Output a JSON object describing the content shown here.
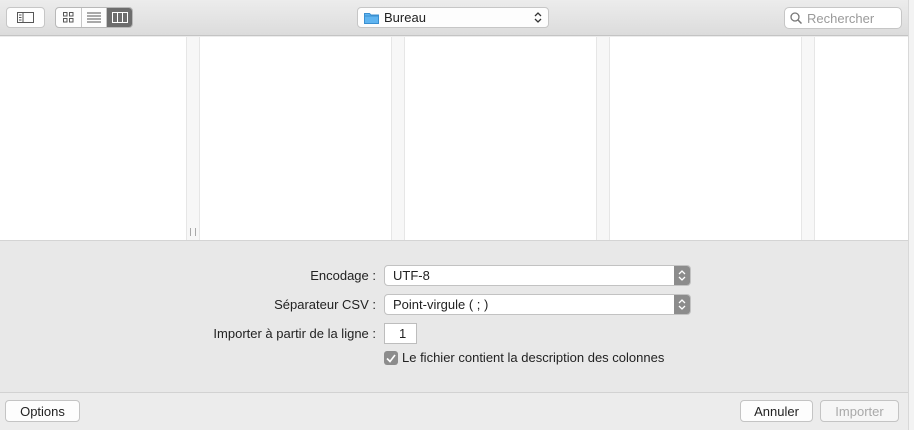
{
  "toolbar": {
    "sidebar_icon": "sidebar-toggle-icon",
    "view_modes": [
      {
        "icon": "icon-view-icon"
      },
      {
        "icon": "list-view-icon"
      },
      {
        "icon": "column-view-icon",
        "selected": true
      }
    ],
    "location": "Bureau",
    "search_placeholder": "Rechercher"
  },
  "options": {
    "encoding_label": "Encodage :",
    "encoding_value": "UTF-8",
    "separator_label": "Séparateur CSV :",
    "separator_value": "Point-virgule ( ; )",
    "start_line_label": "Importer à partir de la ligne :",
    "start_line_value": "1",
    "header_checkbox_label": "Le fichier contient la description des colonnes",
    "header_checkbox_checked": true
  },
  "buttons": {
    "options": "Options",
    "cancel": "Annuler",
    "import": "Importer"
  },
  "colors": {
    "folder_blue": "#5fb4f0",
    "selected_segment": "#6d6d6d",
    "disabled_text": "#a9a9a9"
  }
}
